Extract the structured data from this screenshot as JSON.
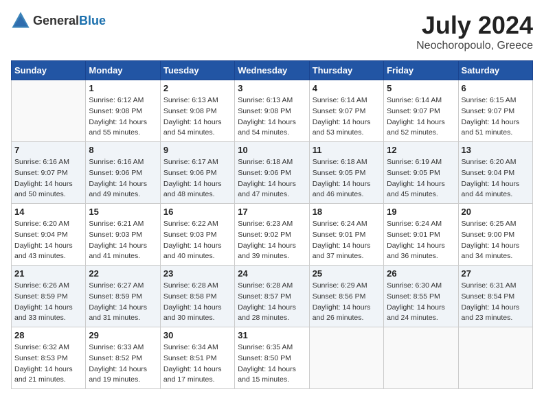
{
  "header": {
    "logo_general": "General",
    "logo_blue": "Blue",
    "month_title": "July 2024",
    "location": "Neochoropoulo, Greece"
  },
  "weekdays": [
    "Sunday",
    "Monday",
    "Tuesday",
    "Wednesday",
    "Thursday",
    "Friday",
    "Saturday"
  ],
  "weeks": [
    [
      {
        "day": "",
        "info": ""
      },
      {
        "day": "1",
        "info": "Sunrise: 6:12 AM\nSunset: 9:08 PM\nDaylight: 14 hours\nand 55 minutes."
      },
      {
        "day": "2",
        "info": "Sunrise: 6:13 AM\nSunset: 9:08 PM\nDaylight: 14 hours\nand 54 minutes."
      },
      {
        "day": "3",
        "info": "Sunrise: 6:13 AM\nSunset: 9:08 PM\nDaylight: 14 hours\nand 54 minutes."
      },
      {
        "day": "4",
        "info": "Sunrise: 6:14 AM\nSunset: 9:07 PM\nDaylight: 14 hours\nand 53 minutes."
      },
      {
        "day": "5",
        "info": "Sunrise: 6:14 AM\nSunset: 9:07 PM\nDaylight: 14 hours\nand 52 minutes."
      },
      {
        "day": "6",
        "info": "Sunrise: 6:15 AM\nSunset: 9:07 PM\nDaylight: 14 hours\nand 51 minutes."
      }
    ],
    [
      {
        "day": "7",
        "info": "Sunrise: 6:16 AM\nSunset: 9:07 PM\nDaylight: 14 hours\nand 50 minutes."
      },
      {
        "day": "8",
        "info": "Sunrise: 6:16 AM\nSunset: 9:06 PM\nDaylight: 14 hours\nand 49 minutes."
      },
      {
        "day": "9",
        "info": "Sunrise: 6:17 AM\nSunset: 9:06 PM\nDaylight: 14 hours\nand 48 minutes."
      },
      {
        "day": "10",
        "info": "Sunrise: 6:18 AM\nSunset: 9:06 PM\nDaylight: 14 hours\nand 47 minutes."
      },
      {
        "day": "11",
        "info": "Sunrise: 6:18 AM\nSunset: 9:05 PM\nDaylight: 14 hours\nand 46 minutes."
      },
      {
        "day": "12",
        "info": "Sunrise: 6:19 AM\nSunset: 9:05 PM\nDaylight: 14 hours\nand 45 minutes."
      },
      {
        "day": "13",
        "info": "Sunrise: 6:20 AM\nSunset: 9:04 PM\nDaylight: 14 hours\nand 44 minutes."
      }
    ],
    [
      {
        "day": "14",
        "info": "Sunrise: 6:20 AM\nSunset: 9:04 PM\nDaylight: 14 hours\nand 43 minutes."
      },
      {
        "day": "15",
        "info": "Sunrise: 6:21 AM\nSunset: 9:03 PM\nDaylight: 14 hours\nand 41 minutes."
      },
      {
        "day": "16",
        "info": "Sunrise: 6:22 AM\nSunset: 9:03 PM\nDaylight: 14 hours\nand 40 minutes."
      },
      {
        "day": "17",
        "info": "Sunrise: 6:23 AM\nSunset: 9:02 PM\nDaylight: 14 hours\nand 39 minutes."
      },
      {
        "day": "18",
        "info": "Sunrise: 6:24 AM\nSunset: 9:01 PM\nDaylight: 14 hours\nand 37 minutes."
      },
      {
        "day": "19",
        "info": "Sunrise: 6:24 AM\nSunset: 9:01 PM\nDaylight: 14 hours\nand 36 minutes."
      },
      {
        "day": "20",
        "info": "Sunrise: 6:25 AM\nSunset: 9:00 PM\nDaylight: 14 hours\nand 34 minutes."
      }
    ],
    [
      {
        "day": "21",
        "info": "Sunrise: 6:26 AM\nSunset: 8:59 PM\nDaylight: 14 hours\nand 33 minutes."
      },
      {
        "day": "22",
        "info": "Sunrise: 6:27 AM\nSunset: 8:59 PM\nDaylight: 14 hours\nand 31 minutes."
      },
      {
        "day": "23",
        "info": "Sunrise: 6:28 AM\nSunset: 8:58 PM\nDaylight: 14 hours\nand 30 minutes."
      },
      {
        "day": "24",
        "info": "Sunrise: 6:28 AM\nSunset: 8:57 PM\nDaylight: 14 hours\nand 28 minutes."
      },
      {
        "day": "25",
        "info": "Sunrise: 6:29 AM\nSunset: 8:56 PM\nDaylight: 14 hours\nand 26 minutes."
      },
      {
        "day": "26",
        "info": "Sunrise: 6:30 AM\nSunset: 8:55 PM\nDaylight: 14 hours\nand 24 minutes."
      },
      {
        "day": "27",
        "info": "Sunrise: 6:31 AM\nSunset: 8:54 PM\nDaylight: 14 hours\nand 23 minutes."
      }
    ],
    [
      {
        "day": "28",
        "info": "Sunrise: 6:32 AM\nSunset: 8:53 PM\nDaylight: 14 hours\nand 21 minutes."
      },
      {
        "day": "29",
        "info": "Sunrise: 6:33 AM\nSunset: 8:52 PM\nDaylight: 14 hours\nand 19 minutes."
      },
      {
        "day": "30",
        "info": "Sunrise: 6:34 AM\nSunset: 8:51 PM\nDaylight: 14 hours\nand 17 minutes."
      },
      {
        "day": "31",
        "info": "Sunrise: 6:35 AM\nSunset: 8:50 PM\nDaylight: 14 hours\nand 15 minutes."
      },
      {
        "day": "",
        "info": ""
      },
      {
        "day": "",
        "info": ""
      },
      {
        "day": "",
        "info": ""
      }
    ]
  ]
}
